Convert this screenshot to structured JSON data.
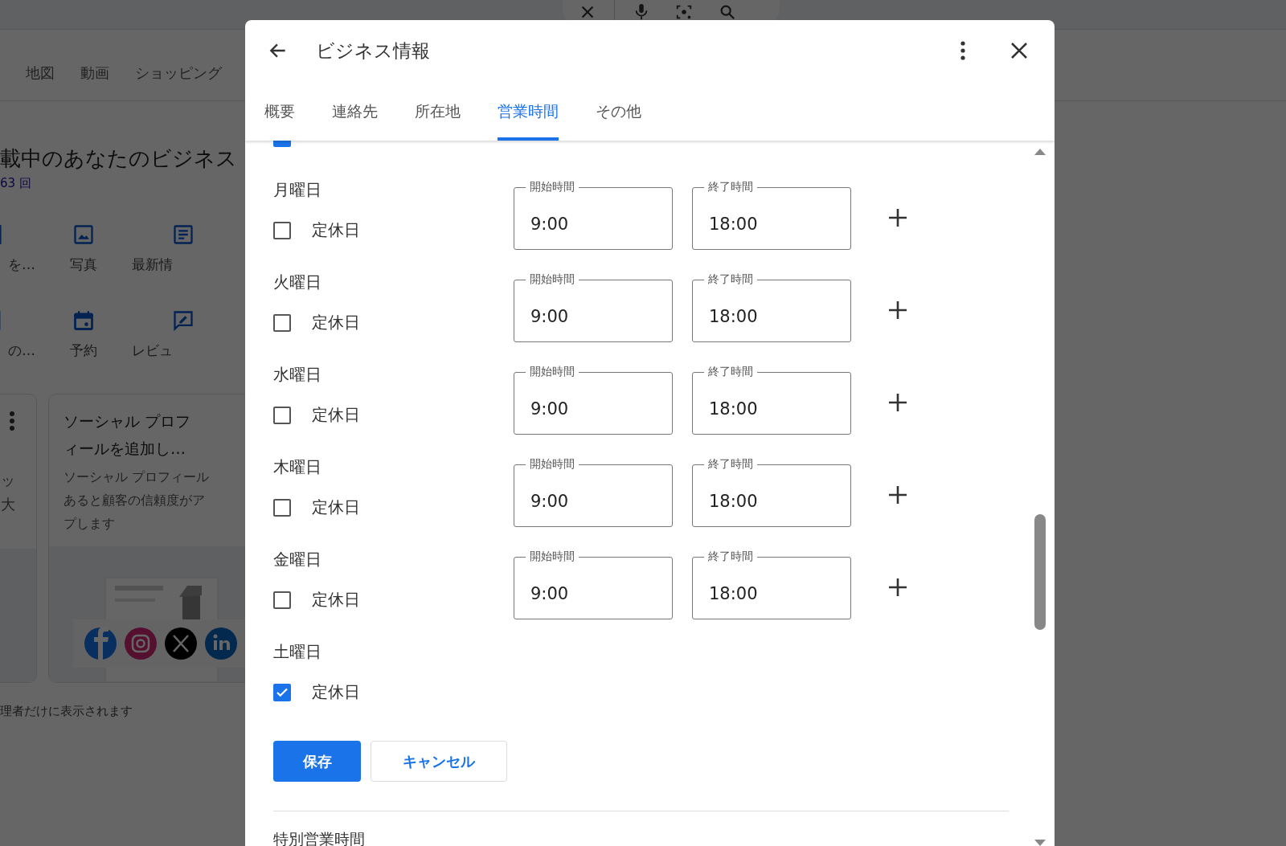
{
  "background": {
    "tabs": [
      "地図",
      "動画",
      "ショッピング"
    ],
    "heading": "載中のあなたのビジネス",
    "views": "63 回",
    "actions": [
      {
        "kind": "edit",
        "label": "を…"
      },
      {
        "kind": "photo",
        "label": "写真"
      },
      {
        "kind": "post",
        "label": "最新情"
      },
      {
        "kind": "store",
        "label": "の…"
      },
      {
        "kind": "calendar",
        "label": "予約"
      },
      {
        "kind": "review",
        "label": "レビュ"
      }
    ],
    "card_partial": {
      "lines": [
        "ッ",
        "大"
      ]
    },
    "card": {
      "title_lines": [
        "ソーシャル プロフ",
        "ィールを追加し…"
      ],
      "body_lines": [
        "ソーシャル プロフィール",
        "あると顧客の信頼度がア",
        "プします"
      ]
    },
    "footer": "理者だけに表示されます"
  },
  "dialog": {
    "title": "ビジネス情報",
    "tabs": [
      {
        "label": "概要",
        "selected": false
      },
      {
        "label": "連絡先",
        "selected": false
      },
      {
        "label": "所在地",
        "selected": false
      },
      {
        "label": "営業時間",
        "selected": true
      },
      {
        "label": "その他",
        "selected": false
      }
    ],
    "partial_row": {
      "checked": true
    },
    "days": [
      {
        "label": "月曜日",
        "closed": false,
        "closed_label": "定休日",
        "start_label": "開始時間",
        "start": "9:00",
        "end_label": "終了時間",
        "end": "18:00"
      },
      {
        "label": "火曜日",
        "closed": false,
        "closed_label": "定休日",
        "start_label": "開始時間",
        "start": "9:00",
        "end_label": "終了時間",
        "end": "18:00"
      },
      {
        "label": "水曜日",
        "closed": false,
        "closed_label": "定休日",
        "start_label": "開始時間",
        "start": "9:00",
        "end_label": "終了時間",
        "end": "18:00"
      },
      {
        "label": "木曜日",
        "closed": false,
        "closed_label": "定休日",
        "start_label": "開始時間",
        "start": "9:00",
        "end_label": "終了時間",
        "end": "18:00"
      },
      {
        "label": "金曜日",
        "closed": false,
        "closed_label": "定休日",
        "start_label": "開始時間",
        "start": "9:00",
        "end_label": "終了時間",
        "end": "18:00"
      },
      {
        "label": "土曜日",
        "closed": true,
        "closed_label": "定休日"
      }
    ],
    "save": "保存",
    "cancel": "キャンセル",
    "section": "特別営業時間"
  }
}
